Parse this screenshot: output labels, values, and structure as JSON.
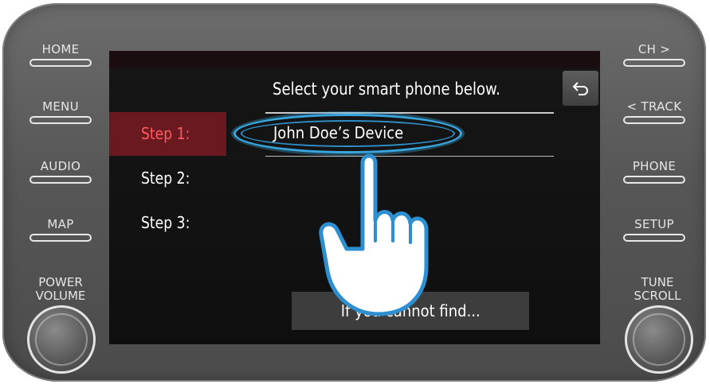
{
  "hardware": {
    "left_buttons": [
      "HOME",
      "MENU",
      "AUDIO",
      "MAP"
    ],
    "right_buttons": [
      "CH >",
      "< TRACK",
      "PHONE",
      "SETUP"
    ],
    "left_knob_label": [
      "POWER",
      "VOLUME"
    ],
    "right_knob_label": [
      "TUNE",
      "SCROLL"
    ]
  },
  "screen": {
    "title": "Select your smart phone below.",
    "back_icon": "back-arrow-icon",
    "steps": [
      "Step 1:",
      "Step 2:",
      "Step 3:"
    ],
    "active_step": 0,
    "devices": [
      "John Doe’s Device"
    ],
    "cannot_find_label": "If you cannot find..."
  },
  "overlay": {
    "hand_icon": "pointing-hand-icon",
    "highlight_color": "#3aa6de"
  },
  "colors": {
    "active_step_bg": "#6b1920",
    "active_step_text": "#ff5a60",
    "bezel": "#5a5a5a"
  }
}
